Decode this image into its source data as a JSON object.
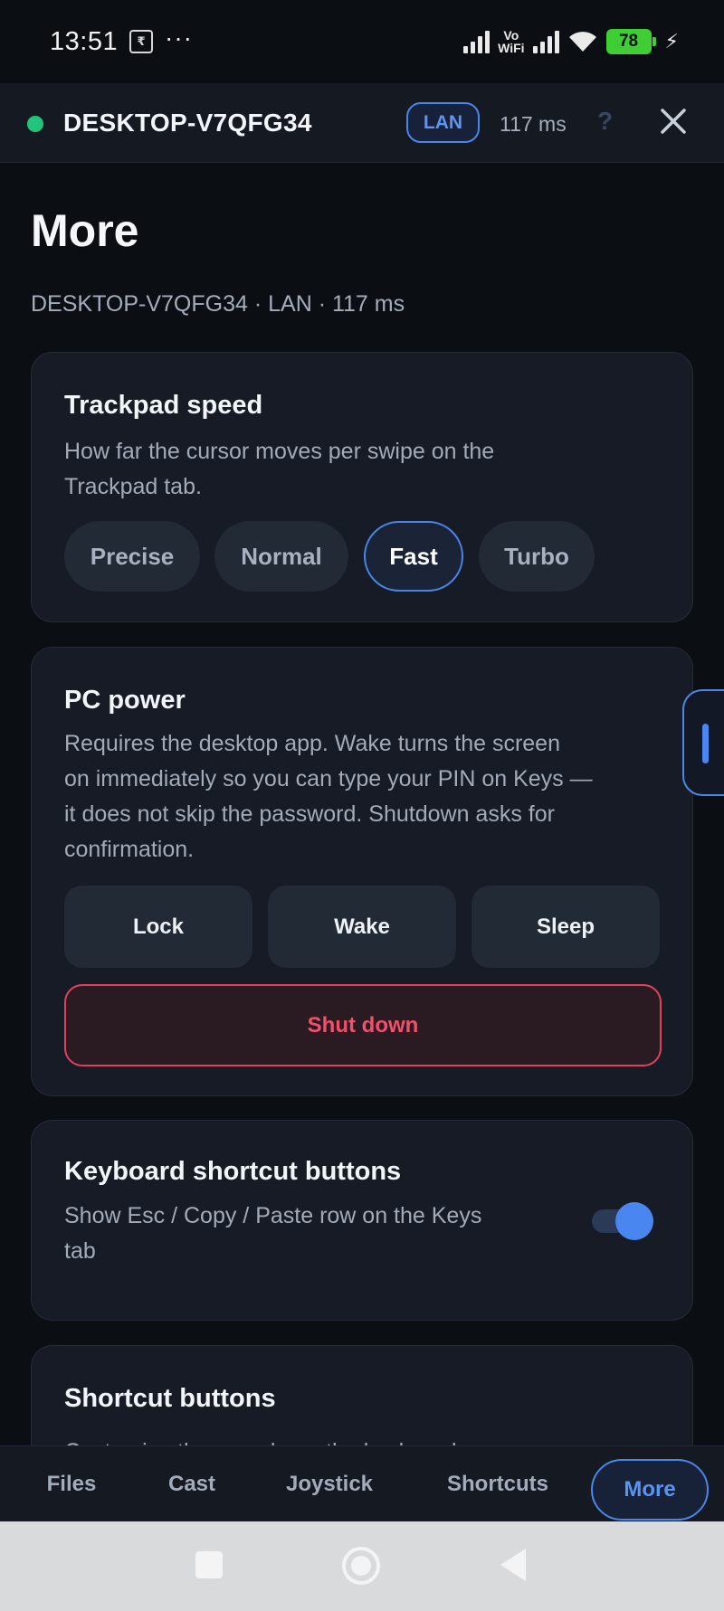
{
  "status_bar": {
    "time": "13:51",
    "rs_icon": "₹",
    "dots": "···",
    "vowifi_top": "Vo",
    "vowifi_bottom": "WiFi",
    "battery": "78"
  },
  "connection": {
    "device_name": "DESKTOP-V7QFG34",
    "connection_type": "LAN",
    "latency": "117 ms",
    "help": "?",
    "status_color": "#22c37a"
  },
  "page": {
    "title": "More",
    "subtitle": "DESKTOP-V7QFG34 · LAN · 117 ms"
  },
  "trackpad": {
    "title": "Trackpad speed",
    "description_lines": [
      "How far the cursor moves per swipe on the",
      "Trackpad tab."
    ],
    "options": [
      "Precise",
      "Normal",
      "Fast",
      "Turbo"
    ],
    "selected": "Fast"
  },
  "power": {
    "title": "PC power",
    "description_lines": [
      "Requires the desktop app. Wake turns the screen",
      "on immediately so you can type your PIN on Keys —",
      "it does not skip the password. Shutdown asks for",
      "confirmation."
    ],
    "buttons": [
      "Lock",
      "Wake",
      "Sleep"
    ],
    "shutdown": "Shut down"
  },
  "keyboard_shortcuts": {
    "title": "Keyboard shortcut buttons",
    "description_lines": [
      "Show Esc / Copy / Paste row on the Keys",
      "tab"
    ],
    "enabled": true
  },
  "shortcut_buttons": {
    "title": "Shortcut buttons",
    "description_partial": "Customize the row above the keyboard"
  },
  "tabs": [
    "Files",
    "Cast",
    "Joystick",
    "Shortcuts",
    "More"
  ],
  "active_tab": "More",
  "colors": {
    "accent": "#4a86e8",
    "danger": "#e0425a",
    "background": "#0b0e13",
    "card": "#161b25"
  }
}
